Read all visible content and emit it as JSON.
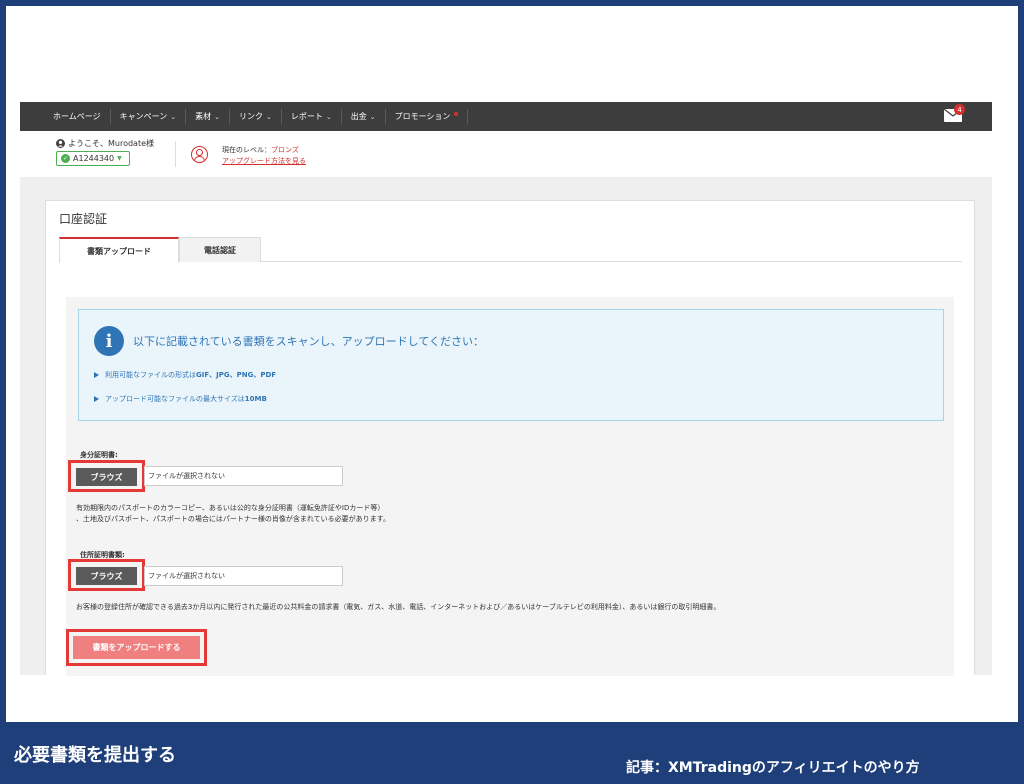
{
  "nav": {
    "items": [
      {
        "label": "ホームページ",
        "chevron": false
      },
      {
        "label": "キャンペーン",
        "chevron": true
      },
      {
        "label": "素材",
        "chevron": true
      },
      {
        "label": "リンク",
        "chevron": true
      },
      {
        "label": "レポート",
        "chevron": true
      },
      {
        "label": "出金",
        "chevron": true
      },
      {
        "label": "プロモーション",
        "chevron": false
      }
    ],
    "mail_badge": "4"
  },
  "user": {
    "welcome": "ようこそ、Murodate様",
    "account": "A1244340",
    "level_label": "現在のレベル：",
    "level_value": "ブロンズ",
    "upgrade_link": "アップグレード方法を見る"
  },
  "card": {
    "title": "口座認証",
    "tabs": [
      "書類アップロード",
      "電話認証"
    ],
    "info": {
      "heading": "以下に記載されている書類をスキャンし、アップロードしてください：",
      "bullet1_prefix": "利用可能なファイルの形式は",
      "bullet1_bold": "GIF、JPG、PNG、PDF",
      "bullet2_prefix": "アップロード可能なファイルの最大サイズは",
      "bullet2_bold": "10MB"
    },
    "id_label": "身分証明書:",
    "browse": "ブラウズ",
    "no_file": "ファイルが選択されない",
    "id_help_1": "有効期限内のパスポートのカラーコピー、あるいは公的な身分証明書（運転免許証やIDカード等）",
    "id_help_2": "、土地及びパスポート、パスポートの場合にはパートナー様の肖像が含まれている必要があります。",
    "addr_label": "住所証明書類:",
    "addr_help": "お客様の登録住所が確認できる過去3か月以内に発行された最近の公共料金の請求書（電気、ガス、水道、電話、インターネットおよび／あるいはケーブルテレビの利用料金）、あるいは銀行の取引明細書。",
    "upload": "書類をアップロードする"
  },
  "footer": {
    "left": "必要書類を提出する",
    "right": "記事：XMTradingのアフィリエイトのやり方"
  }
}
